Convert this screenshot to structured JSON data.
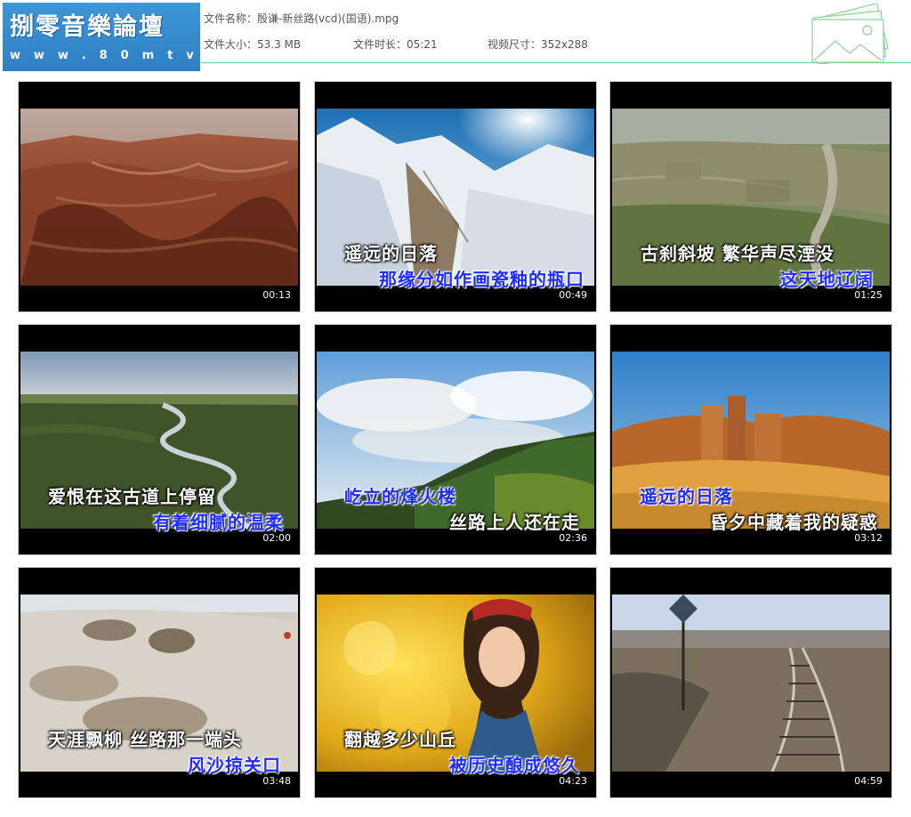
{
  "header": {
    "logo_title": "捌零音樂論壇",
    "logo_url": "w w w . 8 0 m t v . c o m",
    "file_name": "文件名称：殷谦-新丝路(vcd)(国语).mpg",
    "file_size": "文件大小：53.3 MB",
    "duration": "文件时长：05:21",
    "dimensions": "视频尺寸：352x288"
  },
  "colors": {
    "logo_bg": "#3d96d8",
    "rule": "#7cc582",
    "subtitle_blue": "#1f2bff",
    "subtitle_white": "#ffffff"
  },
  "thumbnails": [
    {
      "time": "00:13",
      "line1": "",
      "line2": ""
    },
    {
      "time": "00:49",
      "line1": "遥远的日落",
      "line2": "那缘分如作画瓷釉的瓶口"
    },
    {
      "time": "01:25",
      "line1": "古刹斜坡 繁华声尽湮没",
      "line2": "这天地辽阔"
    },
    {
      "time": "02:00",
      "line1": "爱恨在这古道上停留",
      "line2": "有着细腻的温柔"
    },
    {
      "time": "02:36",
      "line1": "屹立的烽火楼",
      "line2": "丝路上人还在走"
    },
    {
      "time": "03:12",
      "line1": "遥远的日落",
      "line2": "昏夕中藏着我的疑惑"
    },
    {
      "time": "03:48",
      "line1": "天涯飘柳 丝路那一端头",
      "line2": "风沙掠关口"
    },
    {
      "time": "04:23",
      "line1": "翻越多少山丘",
      "line2": "被历史酿成悠久"
    },
    {
      "time": "04:59",
      "line1": "",
      "line2": ""
    }
  ]
}
